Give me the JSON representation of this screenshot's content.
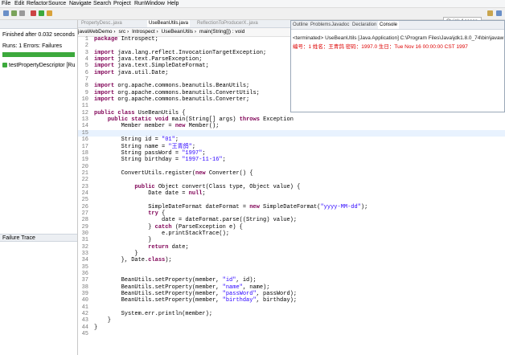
{
  "menu": [
    "File",
    "Edit",
    "Refactor",
    "Source",
    "Navigate",
    "Search",
    "Project",
    "Run",
    "Window",
    "Help"
  ],
  "quick_access": "Quick Access",
  "junit": {
    "finished": "Finished after 0.032 seconds",
    "runs_label": "Runs:",
    "runs_value": "1",
    "errors_label": "Errors:",
    "failures_label": "Failures",
    "test_item": "testPropertyDescriptor [Ru",
    "failure_trace": "Failure Trace"
  },
  "editor": {
    "tabs": [
      "PropertyDesc..java",
      "UseBeanUtils.java",
      "ReflectionToProducerX..java"
    ],
    "active_tab": 1,
    "breadcrumb": [
      "javaWebDemo",
      "src",
      "Introspect",
      "UseBeanUtils",
      "main(String[]) : void"
    ]
  },
  "code_lines": [
    {
      "n": "1",
      "t": "package Introspect;"
    },
    {
      "n": "2",
      "t": ""
    },
    {
      "n": "3",
      "t": "import java.lang.reflect.InvocationTargetException;"
    },
    {
      "n": "4",
      "t": "import java.text.ParseException;"
    },
    {
      "n": "5",
      "t": "import java.text.SimpleDateFormat;"
    },
    {
      "n": "6",
      "t": "import java.util.Date;"
    },
    {
      "n": "7",
      "t": ""
    },
    {
      "n": "8",
      "t": "import org.apache.commons.beanutils.BeanUtils;"
    },
    {
      "n": "9",
      "t": "import org.apache.commons.beanutils.ConvertUtils;"
    },
    {
      "n": "10",
      "t": "import org.apache.commons.beanutils.Converter;"
    },
    {
      "n": "11",
      "t": ""
    },
    {
      "n": "12",
      "t": "public class UseBeanUtils {"
    },
    {
      "n": "13",
      "t": "    public static void main(String[] args) throws Exception"
    },
    {
      "n": "14",
      "t": "        Member member = new Member();"
    },
    {
      "n": "15",
      "t": ""
    },
    {
      "n": "16",
      "t": "        String id = \"01\";"
    },
    {
      "n": "17",
      "t": "        String name = \"王青鸽\";"
    },
    {
      "n": "18",
      "t": "        String passWord = \"1997\";"
    },
    {
      "n": "19",
      "t": "        String birthday = \"1997-11-16\";"
    },
    {
      "n": "20",
      "t": ""
    },
    {
      "n": "21",
      "t": "        ConvertUtils.register(new Converter() {"
    },
    {
      "n": "22",
      "t": ""
    },
    {
      "n": "23",
      "t": "            public Object convert(Class type, Object value) {"
    },
    {
      "n": "24",
      "t": "                Date date = null;"
    },
    {
      "n": "25",
      "t": ""
    },
    {
      "n": "26",
      "t": "                SimpleDateFormat dateFormat = new SimpleDateFormat(\"yyyy-MM-dd\");"
    },
    {
      "n": "27",
      "t": "                try {"
    },
    {
      "n": "28",
      "t": "                    date = dateFormat.parse((String) value);"
    },
    {
      "n": "29",
      "t": "                } catch (ParseException e) {"
    },
    {
      "n": "30",
      "t": "                    e.printStackTrace();"
    },
    {
      "n": "31",
      "t": "                }"
    },
    {
      "n": "32",
      "t": "                return date;"
    },
    {
      "n": "33",
      "t": "            }"
    },
    {
      "n": "34",
      "t": "        }, Date.class);"
    },
    {
      "n": "35",
      "t": ""
    },
    {
      "n": "36",
      "t": ""
    },
    {
      "n": "37",
      "t": "        BeanUtils.setProperty(member, \"id\", id);"
    },
    {
      "n": "38",
      "t": "        BeanUtils.setProperty(member, \"name\", name);"
    },
    {
      "n": "39",
      "t": "        BeanUtils.setProperty(member, \"passWord\", passWord);"
    },
    {
      "n": "40",
      "t": "        BeanUtils.setProperty(member, \"birthday\", birthday);"
    },
    {
      "n": "41",
      "t": ""
    },
    {
      "n": "42",
      "t": "        System.err.println(member);"
    },
    {
      "n": "43",
      "t": "    }"
    },
    {
      "n": "44",
      "t": "}"
    },
    {
      "n": "45",
      "t": ""
    }
  ],
  "highlight_line": 15,
  "console": {
    "tabs": [
      "Outline",
      "Problems",
      "Javadoc",
      "Declaration",
      "Console"
    ],
    "active_tab": 4,
    "terminated": "<terminated> UseBeanUtils [Java Application] C:\\Program Files\\Java\\jdk1.8.0_74\\bin\\javaw",
    "output": "编号：1 姓名：王青鸽 密码：1997.0 生日：Tue Nov 16 00:00:00 CST 1997"
  },
  "colors": {
    "keyword": "#7f0055",
    "string": "#2a00ff",
    "progress": "#3ca93c",
    "error": "#dd0000"
  }
}
